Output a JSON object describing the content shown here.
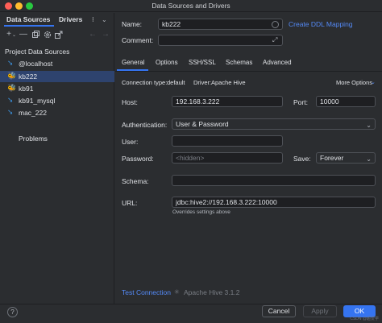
{
  "window": {
    "title": "Data Sources and Drivers"
  },
  "left_panel": {
    "tabs": [
      "Data Sources",
      "Drivers"
    ],
    "tab_overflow": "⁝",
    "section_label": "Project Data Sources",
    "items": [
      {
        "label": "@localhost",
        "icon": "database-icon"
      },
      {
        "label": "kb222",
        "icon": "hive-icon",
        "selected": true
      },
      {
        "label": "kb91",
        "icon": "hive-icon"
      },
      {
        "label": "kb91_mysql",
        "icon": "database-icon"
      },
      {
        "label": "mac_222",
        "icon": "database-icon"
      }
    ],
    "problems": "Problems"
  },
  "form": {
    "name_label": "Name:",
    "name_value": "kb222",
    "create_ddl": "Create DDL Mapping",
    "comment_label": "Comment:",
    "comment_value": "",
    "tabs": [
      "General",
      "Options",
      "SSH/SSL",
      "Schemas",
      "Advanced"
    ],
    "connection_type_label": "Connection type:",
    "connection_type_value": "default",
    "driver_label": "Driver:",
    "driver_value": "Apache Hive",
    "more_options": "More Options",
    "host_label": "Host:",
    "host_value": "192.168.3.222",
    "port_label": "Port:",
    "port_value": "10000",
    "auth_label": "Authentication:",
    "auth_value": "User & Password",
    "user_label": "User:",
    "user_value": "",
    "password_label": "Password:",
    "password_placeholder": "<hidden>",
    "save_label": "Save:",
    "save_value": "Forever",
    "schema_label": "Schema:",
    "schema_value": "",
    "url_label": "URL:",
    "url_value": "jdbc:hive2://192.168.3.222:10000",
    "url_hint": "Overrides settings above",
    "test_connection": "Test Connection",
    "test_status": "Apache Hive 3.1.2"
  },
  "buttons": {
    "help": "?",
    "cancel": "Cancel",
    "apply": "Apply",
    "ok": "OK"
  },
  "watermark": "CSDN @超爱学",
  "colors": {
    "accent": "#3574f0",
    "link": "#548af7",
    "selection": "#2e436e",
    "hive_icon": "#e3b341"
  }
}
